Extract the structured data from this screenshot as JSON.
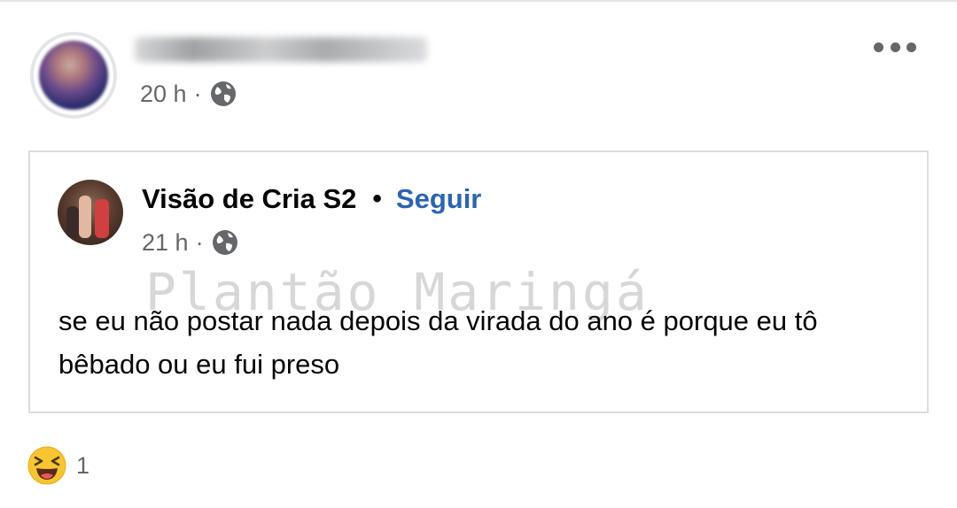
{
  "outer_post": {
    "timestamp": "20 h",
    "separator": "·",
    "privacy_icon": "globe-icon",
    "menu_icon": "more-horizontal-icon"
  },
  "shared_post": {
    "page_name": "Visão de Cria S2",
    "separator_dot": "•",
    "follow_label": "Seguir",
    "timestamp": "21 h",
    "separator": "·",
    "privacy_icon": "globe-icon",
    "text": "se eu não postar nada depois da virada do ano é porque eu tô bêbado ou eu fui preso",
    "watermark": "Plantão Maringá"
  },
  "reactions": {
    "icon": "haha-reaction-icon",
    "count": "1"
  },
  "colors": {
    "link_blue": "#2d64b0",
    "meta_gray": "#65676b",
    "border": "#dadde1",
    "text": "#050505",
    "haha_yellow": "#f7c531"
  }
}
